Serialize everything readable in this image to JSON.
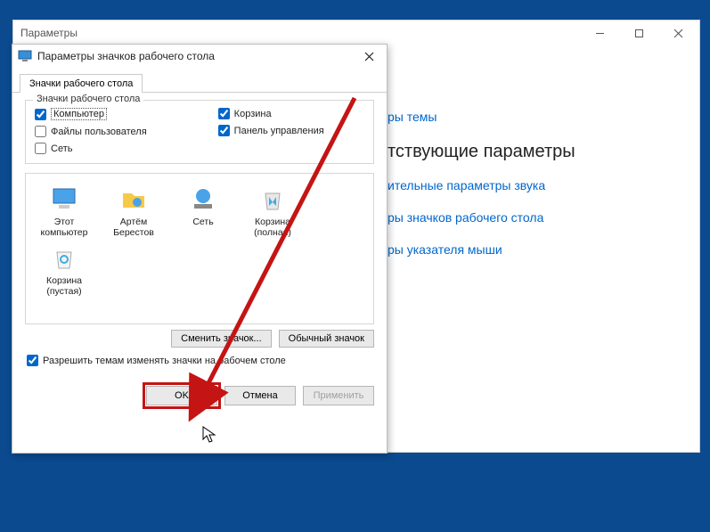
{
  "main": {
    "title": "Параметры",
    "heading": "тствующие параметры",
    "links": {
      "themes": "ры темы",
      "sound": "ительные параметры звука",
      "desktop_icons": "ры значков рабочего стола",
      "cursor": "ры указателя мыши"
    }
  },
  "dialog": {
    "title": "Параметры значков рабочего стола",
    "tab": "Значки рабочего стола",
    "group_legend": "Значки рабочего стола",
    "checkboxes": {
      "computer": {
        "label": "Компьютер",
        "checked": true
      },
      "user_files": {
        "label": "Файлы пользователя",
        "checked": false
      },
      "network": {
        "label": "Сеть",
        "checked": false
      },
      "recycle": {
        "label": "Корзина",
        "checked": true
      },
      "control_panel": {
        "label": "Панель управления",
        "checked": true
      }
    },
    "icons": [
      {
        "name": "Этот компьютер"
      },
      {
        "name": "Артём Берестов"
      },
      {
        "name": "Сеть"
      },
      {
        "name": "Корзина (полная)"
      },
      {
        "name": "Корзина (пустая)"
      }
    ],
    "buttons": {
      "change_icon": "Сменить значок...",
      "default_icon": "Обычный значок"
    },
    "allow_themes": {
      "label": "Разрешить темам изменять значки на рабочем столе",
      "checked": true
    },
    "footer": {
      "ok": "OK",
      "cancel": "Отмена",
      "apply": "Применить"
    }
  }
}
